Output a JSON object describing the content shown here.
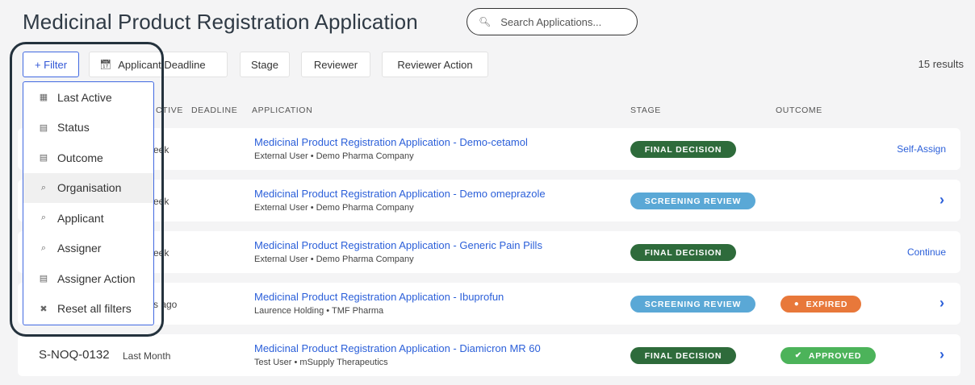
{
  "page": {
    "title": "Medicinal Product Registration Application"
  },
  "search": {
    "placeholder": "Search Applications..."
  },
  "filters": {
    "add_filter": "+ Filter",
    "applicant_deadline": "Applicant Deadline",
    "stage": "Stage",
    "reviewer": "Reviewer",
    "reviewer_action": "Reviewer Action"
  },
  "results_count": "15 results",
  "columns": {
    "active_partial": "CTIVE",
    "deadline": "DEADLINE",
    "application": "APPLICATION",
    "stage": "STAGE",
    "outcome": "OUTCOME"
  },
  "filter_menu": [
    {
      "label": "Last Active",
      "icon": "calendar-icon"
    },
    {
      "label": "Status",
      "icon": "list-icon"
    },
    {
      "label": "Outcome",
      "icon": "list-icon"
    },
    {
      "label": "Organisation",
      "icon": "search-icon"
    },
    {
      "label": "Applicant",
      "icon": "search-icon"
    },
    {
      "label": "Assigner",
      "icon": "search-icon"
    },
    {
      "label": "Assigner Action",
      "icon": "list-icon"
    },
    {
      "label": "Reset all filters",
      "icon": "close-icon"
    }
  ],
  "rows": [
    {
      "partial_when": "eek",
      "title": "Medicinal Product Registration Application - Demo-cetamol",
      "sub": "External User • Demo Pharma Company",
      "stage": "FINAL DECISION",
      "action": "Self-Assign"
    },
    {
      "partial_when": "eek",
      "title": "Medicinal Product Registration Application - Demo omeprazole",
      "sub": "External User • Demo Pharma Company",
      "stage": "SCREENING REVIEW",
      "action": "›"
    },
    {
      "partial_when": "eek",
      "title": "Medicinal Product Registration Application - Generic Pain Pills",
      "sub": "External User • Demo Pharma Company",
      "stage": "FINAL DECISION",
      "action": "Continue"
    },
    {
      "partial_when": "s ago",
      "title": "Medicinal Product Registration Application - Ibuprofun",
      "sub": "Laurence Holding • TMF Pharma",
      "stage": "SCREENING REVIEW",
      "outcome": "EXPIRED",
      "action": "›"
    },
    {
      "serial": "S-NOQ-0132",
      "when": "Last Month",
      "title": "Medicinal Product Registration Application - Diamicron MR 60",
      "sub": "Test User • mSupply Therapeutics",
      "stage": "FINAL DECISION",
      "outcome": "APPROVED",
      "action": "›"
    }
  ],
  "colors": {
    "link": "#2b5fd9",
    "final_decision": "#2e6b3b",
    "screening_review": "#5aa8d6",
    "expired": "#e8783a",
    "approved": "#4cb35a",
    "filter_accent": "#4169e1"
  }
}
